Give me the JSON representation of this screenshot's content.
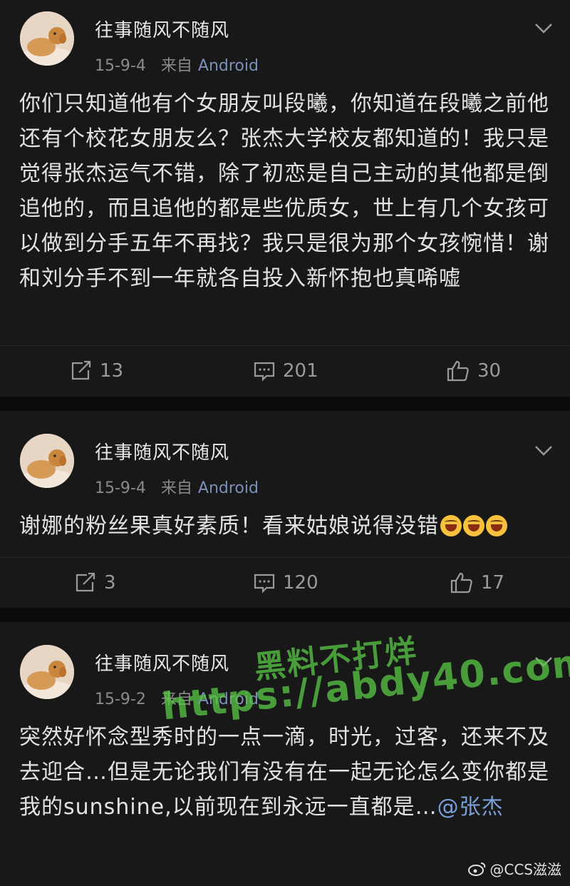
{
  "posts": [
    {
      "username": "往事随风不随风",
      "date": "15-9-4",
      "from": "来自",
      "source": "Android",
      "content": "你们只知道他有个女朋友叫段曦，你知道在段曦之前他还有个校花女朋友么？张杰大学校友都知道的！我只是觉得张杰运气不错，除了初恋是自己主动的其他都是倒追他的，而且追他的都是些优质女，世上有几个女孩可以做到分手五年不再找？我只是很为那个女孩惋惜！谢和刘分手不到一年就各自投入新怀抱也真唏嘘",
      "reposts": "13",
      "comments": "201",
      "likes": "30"
    },
    {
      "username": "往事随风不随风",
      "date": "15-9-4",
      "from": "来自",
      "source": "Android",
      "content": "谢娜的粉丝果真好素质！看来姑娘说得没错",
      "reposts": "3",
      "comments": "120",
      "likes": "17"
    },
    {
      "username": "往事随风不随风",
      "date": "15-9-2",
      "from": "来自",
      "source": "Android",
      "content": "突然好怀念型秀时的一点一滴，时光，过客，还来不及去迎合…但是无论我们有没有在一起无论怎么变你都是我的sunshine,以前现在到永远一直都是…",
      "mention": "@张杰"
    }
  ],
  "watermark": {
    "line1": "黑料不打烊",
    "line2": "https://abdy40.com"
  },
  "credit": "@CCS滋滋",
  "colors": {
    "background": "#101010",
    "card": "#181818",
    "source_link": "#7b8fb8",
    "watermark": "#5ac846"
  }
}
